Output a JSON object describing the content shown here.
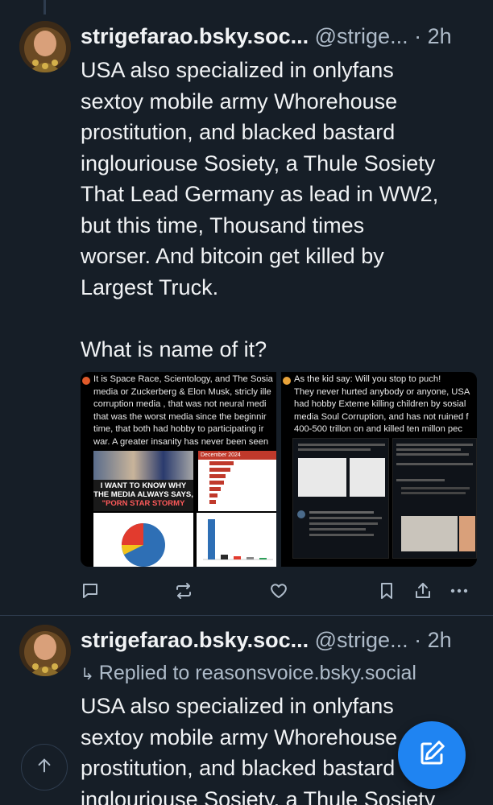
{
  "post1": {
    "display_name": "strigefarao.bsky.soc...",
    "handle": "@strige...",
    "separator": "·",
    "time": "2h",
    "text": "USA also specialized in onlyfans\nsextoy mobile army Whorehouse\nprostitution, and blacked bastard\ninglouriouse Sosiety, a Thule Sosiety\nThat Lead Germany as lead in WW2,\nbut this time, Thousand times\nworser. And bitcoin get killed by\nLargest Truck.\n\nWhat is name of it?",
    "embed": {
      "left_caption": "It is Space Race, Scientology, and The Sosia\nmedia or Zuckerberg & Elon Musk, stricly ille\ncorruption media , that was not neural medi\nthat was the worst media since the beginnir\ntime, that both had hobby to participating ir\nwar. A greater insanity has never been seen",
      "poster_line1": "I WANT TO KNOW WHY",
      "poster_line2": "THE MEDIA ALWAYS SAYS,",
      "poster_line3": "\"PORN STAR STORMY",
      "table_title": "December 2024",
      "right_caption": "As the kid say: Will you stop to puch!\nThey never hurted anybody or anyone, USA\nhad hobby Exteme killing children by sosial\nmedia Soul Corruption, and has not ruined f\n400-500 trillon on and killed ten millon pec"
    },
    "actions": {
      "reply": "reply-icon",
      "repost": "repost-icon",
      "like": "heart-icon",
      "bookmark": "bookmark-icon",
      "share": "share-icon",
      "more": "more-icon"
    }
  },
  "post2": {
    "display_name": "strigefarao.bsky.soc...",
    "handle": "@strige...",
    "separator": "·",
    "time": "2h",
    "replied_to": "Replied to reasonsvoice.bsky.social",
    "text": "USA also specialized in onlyfans\nsextoy mobile army Whorehouse\nprostitution, and blacked bastard\ninglouriouse Sosiety, a Thule Sosiety"
  },
  "fab": {
    "compose": "compose-icon",
    "scroll_top": "arrow-up-icon"
  },
  "colors": {
    "background": "#161e27",
    "accent": "#1f84f2",
    "muted": "#aebbc9",
    "divider": "#2e3c4e"
  }
}
